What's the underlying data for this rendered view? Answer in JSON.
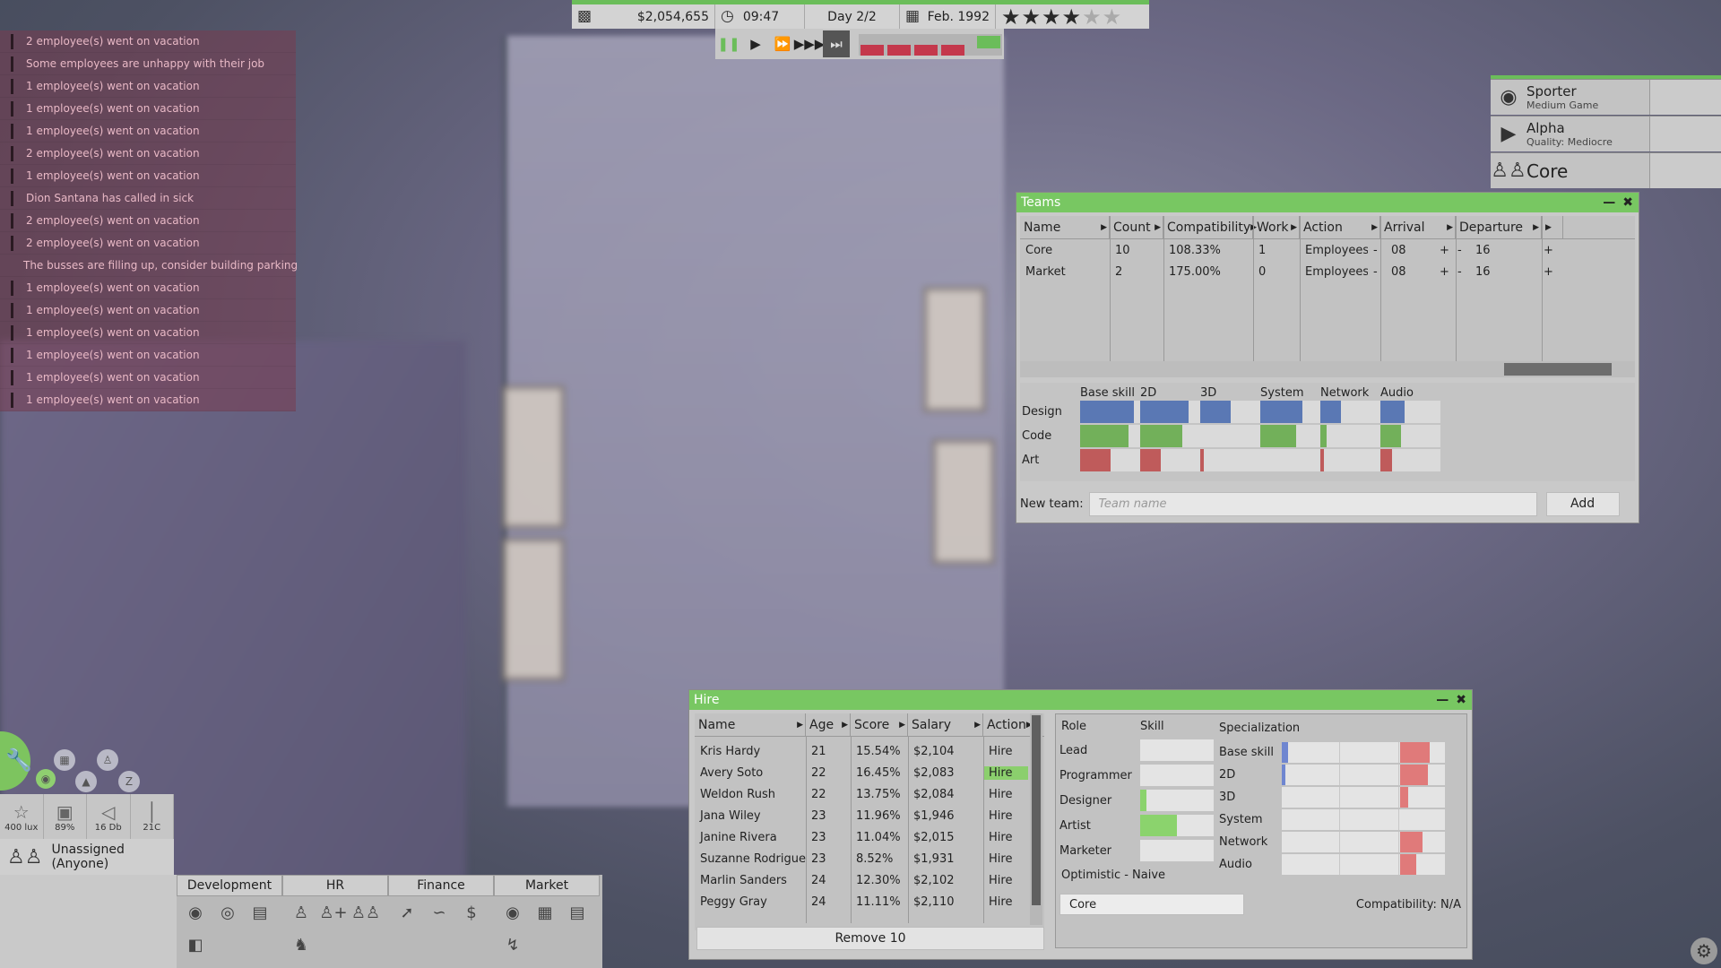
{
  "notifications": [
    "2 employee(s) went on vacation",
    "Some employees are unhappy with their job",
    "1 employee(s) went on vacation",
    "1 employee(s) went on vacation",
    "1 employee(s) went on vacation",
    "2 employee(s) went on vacation",
    "1 employee(s) went on vacation",
    "Dion Santana has called in sick",
    "2 employee(s) went on vacation",
    "2 employee(s) went on vacation",
    "The busses are filling up, consider building parking",
    "1 employee(s) went on vacation",
    "1 employee(s) went on vacation",
    "1 employee(s) went on vacation",
    "1 employee(s) went on vacation",
    "1 employee(s) went on vacation",
    "1 employee(s) went on vacation"
  ],
  "topbar": {
    "money": "$2,054,655",
    "time": "09:47",
    "day": "Day 2/2",
    "date": "Feb. 1992",
    "stars": 4,
    "max_stars": 6
  },
  "projects": [
    {
      "icon": "globe-icon",
      "title": "Sporter",
      "subtitle": "Medium Game"
    },
    {
      "icon": "play-icon",
      "title": "Alpha",
      "subtitle": "Quality: Mediocre"
    },
    {
      "icon": "people-icon",
      "title": "Core",
      "subtitle": ""
    }
  ],
  "teams": {
    "title": "Teams",
    "headers": [
      "Name",
      "Count",
      "Compatibility",
      "Work",
      "Action",
      "Arrival",
      "Departure"
    ],
    "rows": [
      {
        "name": "Core",
        "count": "10",
        "compat": "108.33%",
        "work": "1",
        "action": "Employees",
        "minus1": "-",
        "arrival": "08",
        "plus1": "+",
        "minus2": "-",
        "departure": "16",
        "plus2": "+"
      },
      {
        "name": "Market",
        "count": "2",
        "compat": "175.00%",
        "work": "0",
        "action": "Employees",
        "minus1": "-",
        "arrival": "08",
        "plus1": "+",
        "minus2": "-",
        "departure": "16",
        "plus2": "+"
      }
    ],
    "skill_headers": [
      "Base skill",
      "2D",
      "3D",
      "System",
      "Network",
      "Audio"
    ],
    "skill_rows": [
      {
        "label": "Design",
        "color": "#5a78b4",
        "values": [
          0.9,
          0.8,
          0.5,
          0.7,
          0.35,
          0.4
        ]
      },
      {
        "label": "Code",
        "color": "#72b05a",
        "values": [
          0.8,
          0.7,
          0.0,
          0.6,
          0.1,
          0.35
        ]
      },
      {
        "label": "Art",
        "color": "#bf5b5b",
        "values": [
          0.5,
          0.35,
          0.06,
          0.0,
          0.06,
          0.2
        ]
      }
    ],
    "new_team_label": "New team:",
    "new_team_placeholder": "Team name",
    "add_label": "Add"
  },
  "hire": {
    "title": "Hire",
    "headers": [
      "Name",
      "Age",
      "Score",
      "Salary",
      "Action"
    ],
    "rows": [
      {
        "name": "Kris Hardy",
        "age": "21",
        "score": "15.54%",
        "salary": "$2,104",
        "action": "Hire"
      },
      {
        "name": "Avery Soto",
        "age": "22",
        "score": "16.45%",
        "salary": "$2,083",
        "action": "Hire"
      },
      {
        "name": "Weldon Rush",
        "age": "22",
        "score": "13.75%",
        "salary": "$2,084",
        "action": "Hire"
      },
      {
        "name": "Jana Wiley",
        "age": "23",
        "score": "11.96%",
        "salary": "$1,946",
        "action": "Hire"
      },
      {
        "name": "Janine Rivera",
        "age": "23",
        "score": "11.04%",
        "salary": "$2,015",
        "action": "Hire"
      },
      {
        "name": "Suzanne Rodrigue",
        "age": "23",
        "score": "8.52%",
        "salary": "$1,931",
        "action": "Hire"
      },
      {
        "name": "Marlin Sanders",
        "age": "24",
        "score": "12.30%",
        "salary": "$2,102",
        "action": "Hire"
      },
      {
        "name": "Peggy Gray",
        "age": "24",
        "score": "11.11%",
        "salary": "$2,110",
        "action": "Hire"
      }
    ],
    "remove_label": "Remove 10",
    "role_header": "Role",
    "skill_header": "Skill",
    "spec_header": "Specialization",
    "roles": [
      {
        "label": "Lead",
        "value": 0.0
      },
      {
        "label": "Programmer",
        "value": 0.0
      },
      {
        "label": "Designer",
        "value": 0.08
      },
      {
        "label": "Artist",
        "value": 0.5
      },
      {
        "label": "Marketer",
        "value": 0.0
      }
    ],
    "specs": [
      {
        "label": "Base skill",
        "blue": 0.04,
        "red": 0.18
      },
      {
        "label": "2D",
        "blue": 0.02,
        "red": 0.17
      },
      {
        "label": "3D",
        "blue": 0.0,
        "red": 0.05
      },
      {
        "label": "System",
        "blue": 0.0,
        "red": 0.0
      },
      {
        "label": "Network",
        "blue": 0.0,
        "red": 0.14
      },
      {
        "label": "Audio",
        "blue": 0.0,
        "red": 0.1
      }
    ],
    "trait": "Optimistic - Naive",
    "team_value": "Core",
    "compat_text": "Compatibility: N/A"
  },
  "stats": [
    {
      "icon": "bulb-icon",
      "value": "400 lux"
    },
    {
      "icon": "picture-icon",
      "value": "89%"
    },
    {
      "icon": "speaker-icon",
      "value": "16 Db"
    },
    {
      "icon": "thermometer-icon",
      "value": "21C"
    }
  ],
  "unassigned": "Unassigned (Anyone)",
  "nav_tabs": [
    "Development",
    "HR",
    "Finance",
    "Market"
  ]
}
